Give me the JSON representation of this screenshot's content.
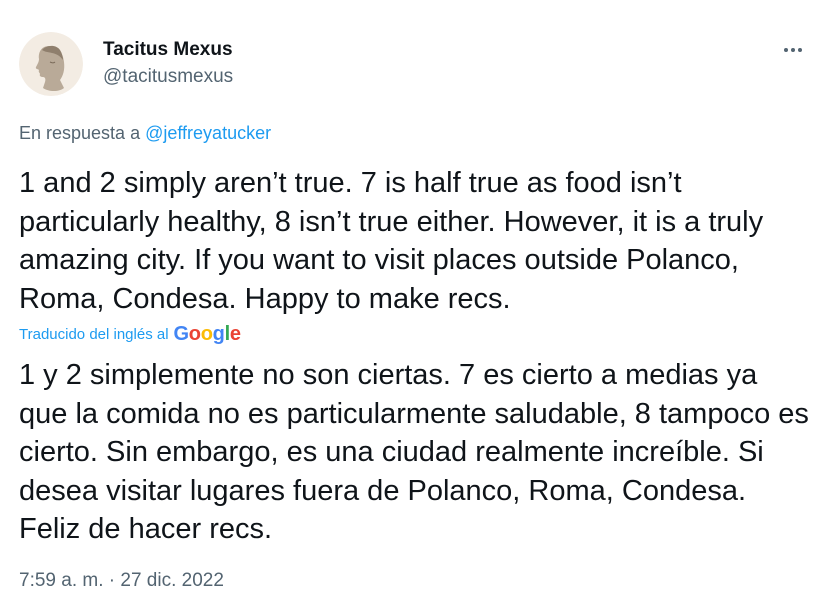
{
  "author": {
    "name": "Tacitus Mexus",
    "handle": "@tacitusmexus"
  },
  "reply": {
    "prefix": "En respuesta a",
    "mention": "@jeffreyatucker"
  },
  "tweet": {
    "text": "1 and 2 simply aren’t true. 7 is half true as food isn’t particularly healthy, 8 isn’t true either. However, it is a truly amazing city. If you want to visit places outside Polanco, Roma, Condesa. Happy to make recs."
  },
  "translation": {
    "label": "Traducido del inglés al",
    "provider_letters": [
      "G",
      "o",
      "o",
      "g",
      "l",
      "e"
    ],
    "text": "1 y 2 simplemente no son ciertas. 7 es cierto a medias ya que la comida no es particularmente saludable, 8 tampoco es cierto. Sin embargo, es una ciudad realmente increíble. Si desea visitar lugares fuera de Polanco, Roma, Condesa. Feliz de hacer recs."
  },
  "meta": {
    "time": "7:59 a. m.",
    "separator": "·",
    "date": "27 dic. 2022"
  },
  "icons": {
    "avatar": "roman-bust-profile-avatar",
    "more": "more-options-icon"
  },
  "colors": {
    "link": "#1d9bf0",
    "secondary_text": "#536471",
    "primary_text": "#0f1419"
  }
}
